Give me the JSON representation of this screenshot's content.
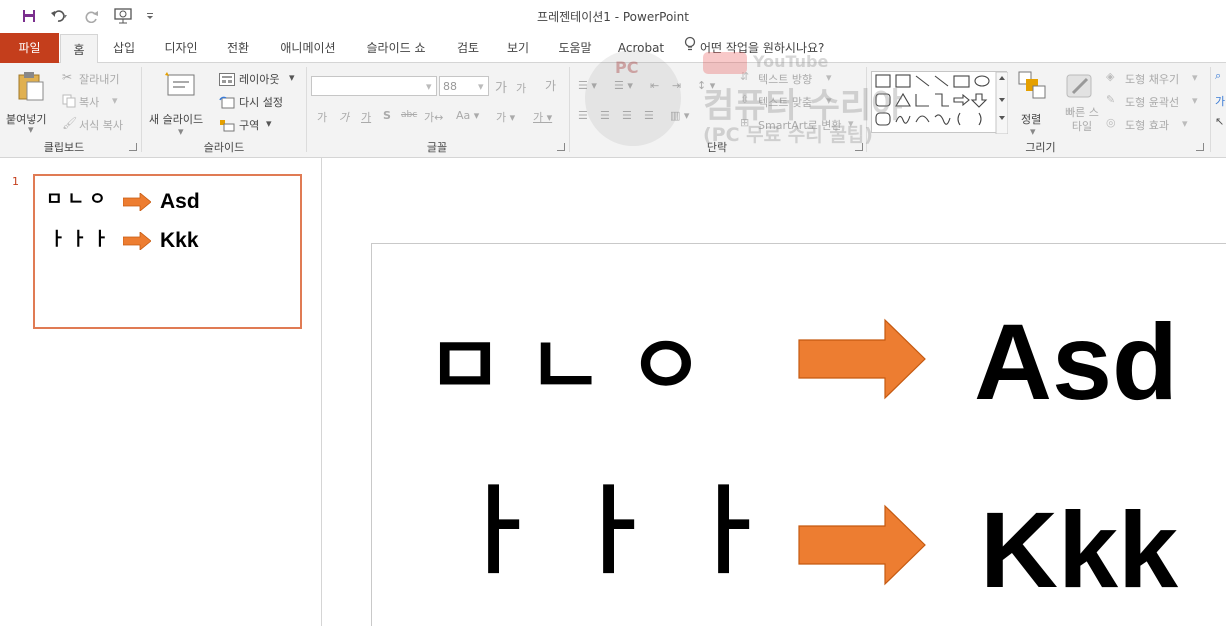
{
  "window": {
    "title": "프레젠테이션1  -  PowerPoint"
  },
  "tabs": {
    "file": "파일",
    "home": "홈",
    "insert": "삽입",
    "design": "디자인",
    "transitions": "전환",
    "animations": "애니메이션",
    "slideshow": "슬라이드 쇼",
    "review": "검토",
    "view": "보기",
    "help": "도움말",
    "acrobat": "Acrobat",
    "tellme": "어떤 작업을 원하시나요?"
  },
  "ribbon": {
    "clipboard": {
      "paste": "붙여넣기",
      "cut": "잘라내기",
      "copy": "복사",
      "format_painter": "서식 복사",
      "group_label": "클립보드"
    },
    "slides": {
      "new_slide": "새 슬라이드",
      "layout": "레이아웃",
      "reset": "다시 설정",
      "section": "구역",
      "group_label": "슬라이드"
    },
    "font": {
      "size": "88",
      "group_label": "글꼴"
    },
    "paragraph": {
      "text_direction": "텍스트 방향",
      "align_text": "텍스트 맞춤",
      "smartart": "SmartArt로 변환",
      "group_label": "단락"
    },
    "drawing": {
      "arrange": "정렬",
      "quick_styles": "빠른 스타일",
      "shape_fill": "도형 채우기",
      "shape_outline": "도형 윤곽선",
      "shape_effects": "도형 효과",
      "group_label": "그리기"
    }
  },
  "watermark": {
    "line1": "컴퓨터 수리야",
    "line2": "(PC 무료 수리 꿀팁)",
    "logo": "PC",
    "youtube": "YouTube"
  },
  "thumbnail": {
    "number": "1"
  },
  "slide": {
    "row1_left": "ㅁ ㄴ ㅇ",
    "row1_right": "Asd",
    "row2_left": "ㅏ ㅏ ㅏ",
    "row2_right": "Kkk"
  },
  "colors": {
    "file_tab": "#c43e1c",
    "arrow_fill": "#ed7d31",
    "thumb_border": "#e07b54",
    "quick_access_icon": "#7b2f8e"
  }
}
